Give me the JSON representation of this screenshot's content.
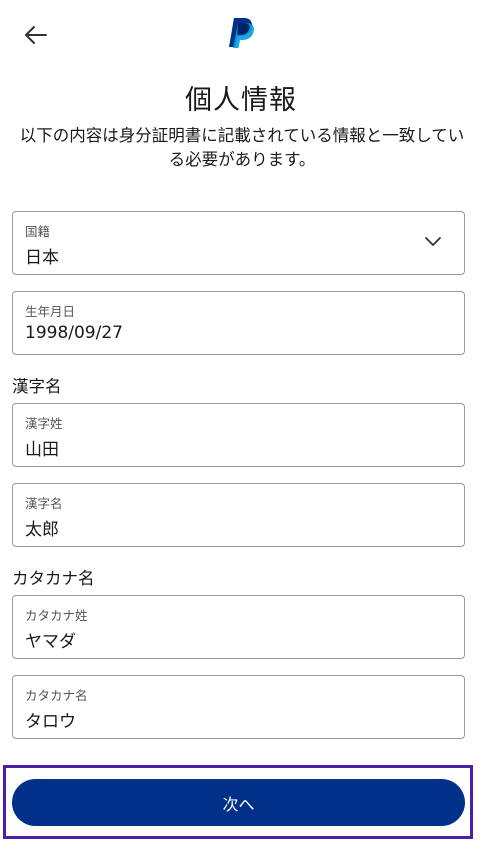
{
  "header": {
    "back_icon": "arrow-left-icon",
    "logo": "paypal-logo"
  },
  "title": "個人情報",
  "subtitle": "以下の内容は身分証明書に記載されている情報と一致している必要があります。",
  "fields": {
    "nationality": {
      "label": "国籍",
      "value": "日本",
      "icon": "chevron-down-icon"
    },
    "birthdate": {
      "label": "生年月日",
      "value": "1998/09/27"
    },
    "kanji_section": "漢字名",
    "kanji_last": {
      "label": "漢字姓",
      "value": "山田"
    },
    "kanji_first": {
      "label": "漢字名",
      "value": "太郎"
    },
    "katakana_section": "カタカナ名",
    "katakana_last": {
      "label": "カタカナ姓",
      "value": "ヤマダ"
    },
    "katakana_first": {
      "label": "カタカナ名",
      "value": "タロウ"
    }
  },
  "next_button": "次へ",
  "colors": {
    "primary": "#003087",
    "logo_dark": "#003087",
    "logo_light": "#009cde",
    "highlight": "#4b1fa8"
  }
}
